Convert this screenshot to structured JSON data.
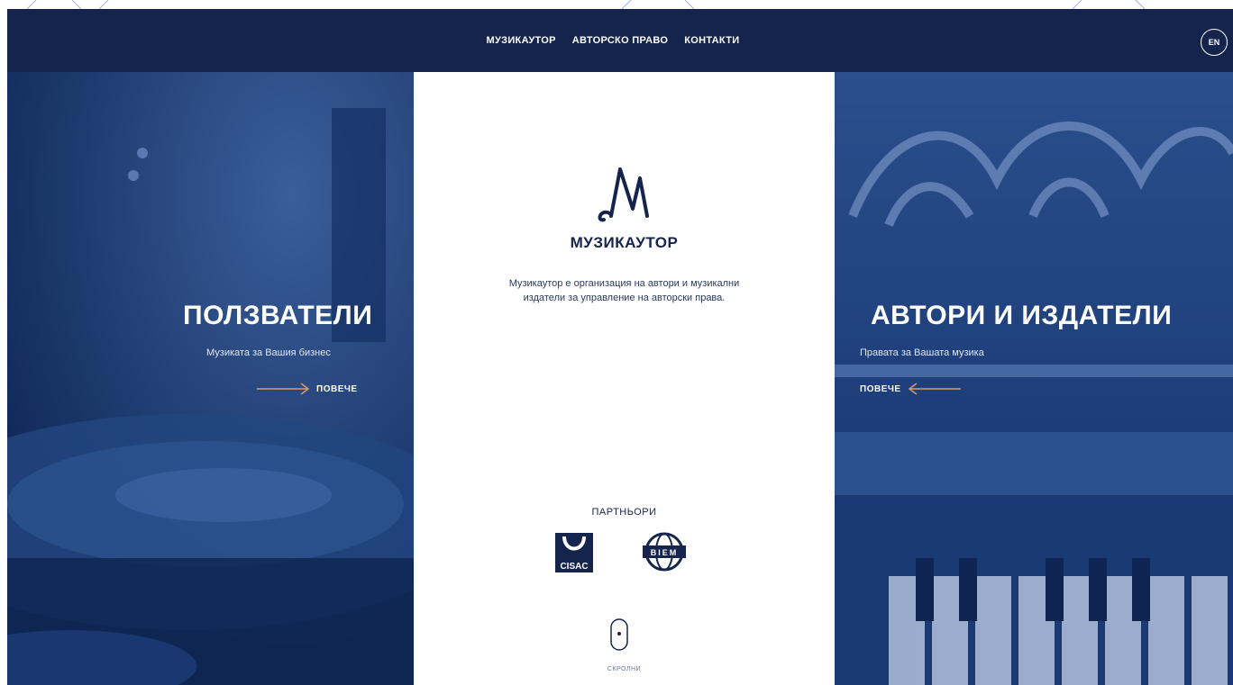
{
  "nav": {
    "items": [
      "МУЗИКАУТОР",
      "АВТОРСКО ПРАВО",
      "КОНТАКТИ"
    ],
    "language": "EN"
  },
  "left_panel": {
    "title": "ПОЛЗВАТЕЛИ",
    "subtitle": "Музиката за Вашия бизнес",
    "more_label": "ПОВЕЧЕ"
  },
  "right_panel": {
    "title": "АВТОРИ И ИЗДАТЕЛИ",
    "subtitle": "Правата за Вашата музика",
    "more_label": "ПОВЕЧЕ"
  },
  "center": {
    "brand": "МУЗИКАУТОР",
    "description_line1": "Музикаутор е организация на автори и музикални",
    "description_line2": "издатели за управление на авторски права.",
    "partners_title": "ПАРТНЬОРИ",
    "partners": [
      {
        "name": "CISAC",
        "logo_text": "CISAC"
      },
      {
        "name": "BIEM",
        "logo_text": "BIEM"
      }
    ],
    "scroll_label": "СКРОЛНИ"
  },
  "colors": {
    "navy": "#14244d",
    "panel_blue": "#1b3a74",
    "accent_arrow": "#d99b6c",
    "white": "#ffffff"
  }
}
